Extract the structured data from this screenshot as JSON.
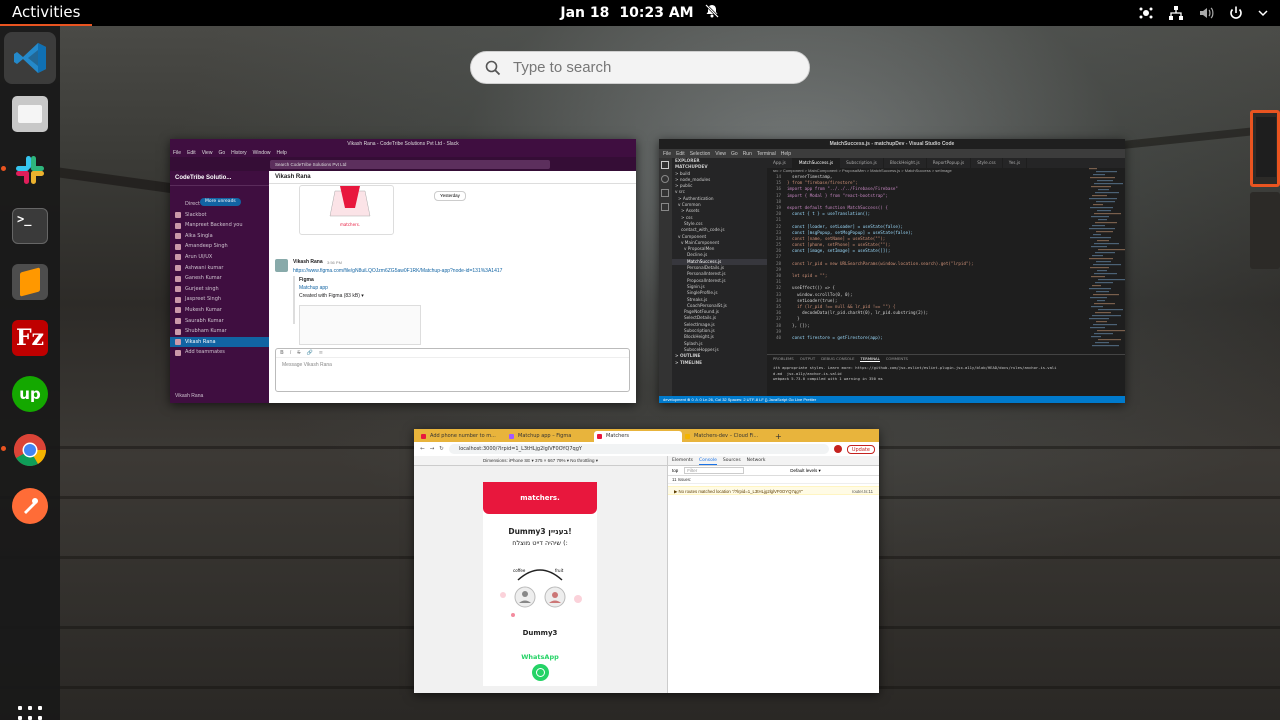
{
  "topbar": {
    "activities": "Activities",
    "date": "Jan 18",
    "time": "10:23 AM"
  },
  "search": {
    "placeholder": "Type to search"
  },
  "dock": {
    "apps": [
      "Visual Studio Code",
      "Files",
      "Slack",
      "Terminal",
      "Sublime Text",
      "FileZilla",
      "Upwork",
      "Google Chrome",
      "Postman"
    ],
    "show_apps": "Show Applications"
  },
  "slack": {
    "title": "Vikash Rana - CodeTribe Solutions Pvt Ltd - Slack",
    "menu": [
      "File",
      "Edit",
      "View",
      "Go",
      "History",
      "Window",
      "Help"
    ],
    "search": "Search CodeTribe Solutions Pvt Ltd",
    "workspace": "CodeTribe Solutio...",
    "more_unreads": "More unreads",
    "channels": [
      "Direct messages",
      "Slackbot",
      "Manpreet Backend  you",
      "Alka Singla",
      "Amandeep Singh",
      "Arun UI/UX",
      "Ashwani kumar",
      "Ganesh Kumar",
      "Gurjeet singh",
      "Jaspreet Singh",
      "Mukesh Kumar",
      "Saurabh Kumar",
      "Shubham Kumar",
      "Vikash Rana",
      "Add teammates"
    ],
    "selected_index": 13,
    "channel_header": "Vikash Rana",
    "yesterday": "Yesterday",
    "message_author": "Vikash Rana",
    "message_time": "3:56 PM",
    "message_link": "https://www.figma.com/file/gN8uiLQOJzm6ZG5aw0F1RK/Matchup-app?node-id=131%3A1417",
    "embed_source": "Figma",
    "embed_title": "Matchup app",
    "embed_sub": "Created with Figma (83 kB) ▾",
    "composer_placeholder": "Message Vikash Rana",
    "user_footer": "Vikash Rana"
  },
  "vscode": {
    "title": "MatchSuccess.js - matchupDev - Visual Studio Code",
    "menu": [
      "File",
      "Edit",
      "Selection",
      "View",
      "Go",
      "Run",
      "Terminal",
      "Help"
    ],
    "tabs": [
      "App.js",
      "MatchSuccess.js",
      "Subscription.js",
      "BlockHeight.js",
      "ReportPopup.js",
      "Style.css",
      "Yes.js"
    ],
    "breadcrumb": "src > Component > MainComponent > ProposalMen > MatchSuccess.js > MatchSuccess > setImage",
    "explorer": [
      "EXPLORER",
      "MATCHUPDEV",
      "> build",
      "> node_modules",
      "> public",
      "v src",
      "  > Authentication",
      "  v Common",
      "    > Assets",
      "    > css",
      "      Style.css",
      "    contact_with_code.js",
      "  v Component",
      "    v MainComponent",
      "      v ProposalMen",
      "        Decline.js",
      "        MatchSuccess.js",
      "        PersonalDetails.js",
      "        PersonalInterest.js",
      "        ProposalInterest.js",
      "        Signin.js",
      "        SingleProfile.js",
      "        Streaks.js",
      "        CoachPersonalSt.js",
      "      PageNotFound.js",
      "      SelectDetails.js",
      "      SelectImage.js",
      "      Subscription.js",
      "      BlockHeight.js",
      "      Splash.js",
      "      SubsceHopper.js",
      "> OUTLINE",
      "> TIMELINE"
    ],
    "code": [
      [
        "14",
        "  serverTimestamp,"
      ],
      [
        "15",
        "} from \"firebase/firestore\";"
      ],
      [
        "16",
        "import app from \"../../../Firebase/Firebase\""
      ],
      [
        "17",
        "import { Modal } from \"react-bootstrap\";"
      ],
      [
        "18",
        ""
      ],
      [
        "19",
        "export default function MatchSuccess() {"
      ],
      [
        "20",
        "  const { t } = useTranslation();"
      ],
      [
        "21",
        ""
      ],
      [
        "22",
        "  const [loader, setLoader] = useState(false);"
      ],
      [
        "23",
        "  const [msgPopup, setMsgPopup] = useState(false);"
      ],
      [
        "24",
        "  const [name, setName] = useState(\"\");"
      ],
      [
        "25",
        "  const [phone, setPhone] = useState(\"\");"
      ],
      [
        "26",
        "  const [image, setImage] = useState([]);"
      ],
      [
        "27",
        ""
      ],
      [
        "28",
        "  const lr_pid = new URLSearchParams(window.location.search).get(\"lrpid\");"
      ],
      [
        "29",
        ""
      ],
      [
        "30",
        "  let spid = \"\";"
      ],
      [
        "31",
        ""
      ],
      [
        "32",
        "  useEffect(() => {"
      ],
      [
        "33",
        "    window.scrollTo(0, 0);"
      ],
      [
        "34",
        "    setLoader(true);"
      ],
      [
        "35",
        "    if (lr_pid !== null && lr_pid !== \"\") {"
      ],
      [
        "36",
        "      decodeData(lr_pid.charAt(0), lr_pid.substring(2));"
      ],
      [
        "37",
        "    }"
      ],
      [
        "38",
        "  }, []);"
      ],
      [
        "39",
        ""
      ],
      [
        "40",
        "  const firestore = getFirestore(app);"
      ]
    ],
    "panel_tabs": [
      "PROBLEMS",
      "OUTPUT",
      "DEBUG CONSOLE",
      "TERMINAL",
      "COMMENTS"
    ],
    "terminal": [
      "ith appropriate styles. Learn more: https://github.com/jsx-eslint/eslint-plugin-jsx-a11y/blob/HEAD/docs/rules/anchor-is-vali",
      "d.md  jsx-a11y/anchor-is-valid",
      "",
      "webpack 5.73.0 compiled with 1 warning in 350 ms"
    ],
    "status": "development  ⊗ 0 ⚠ 0   Ln 26, Col 32   Spaces: 2   UTF-8   LF   {} JavaScript   Go Live   Prettier"
  },
  "chrome": {
    "tabs": [
      "Add phone number to m...",
      "Matchup app – Figma",
      "Matchers",
      "Matchers-dev – Cloud Fi..."
    ],
    "active_tab": 2,
    "new_tab": "+",
    "url": "localhost:3000/?lrpid=1_L3tHLjg2lglVF0OYQ7qgY",
    "update": "Update",
    "device_bar": "Dimensions: iPhone SE ▾    375  ×  667    79% ▾   No throttling ▾",
    "devtools_tabs": [
      "Elements",
      "Console",
      "Sources",
      "Network"
    ],
    "console_filter": "Filter",
    "default_levels": "Default levels ▾",
    "issues": "11 Issues:",
    "console_warning": "▶ No routes matched location \"/?lrpid=1_L3tHLjg2lglVF0OYQ7qgY\"",
    "console_source": "router.ts:11",
    "top_context": "top",
    "app": {
      "brand": "matchers.",
      "heading": "Dummy3 בעניין!",
      "subheading": "שיהיה דייט מוצלח (:",
      "name": "Dummy3",
      "whatsapp": "WhatsApp",
      "left_label": "coffee",
      "right_label": "fruit"
    }
  }
}
